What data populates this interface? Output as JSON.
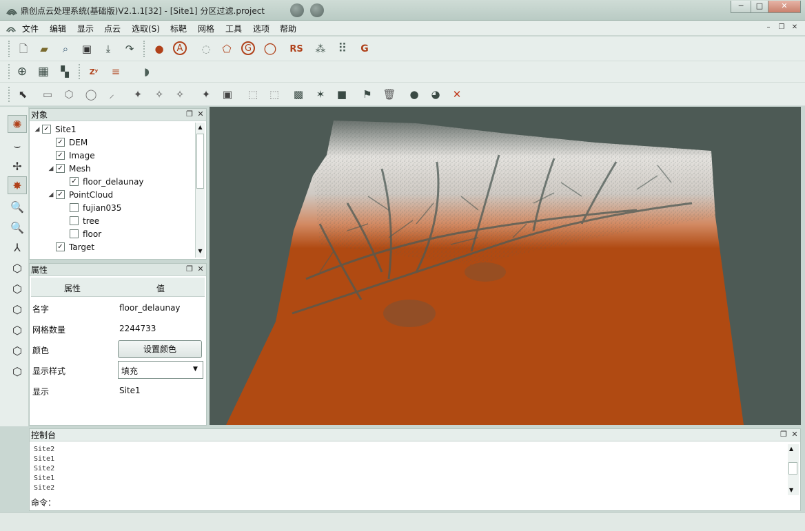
{
  "window": {
    "title": "鼎创点云处理系统(基础版)V2.1.1[32] - [Site1] 分区过滤.project",
    "controls": {
      "minimize": "─",
      "maximize": "□",
      "close": "✕"
    }
  },
  "menubar": {
    "items": [
      "文件",
      "编辑",
      "显示",
      "点云",
      "选取(S)",
      "标靶",
      "网格",
      "工具",
      "选项",
      "帮助"
    ],
    "mdi_controls": {
      "minimize": "–",
      "restore": "❐",
      "close": "✕"
    }
  },
  "objects_panel": {
    "title": "对象",
    "tree": [
      {
        "label": "Site1",
        "checked": true,
        "expander": "◢",
        "indent": 0
      },
      {
        "label": "DEM",
        "checked": true,
        "expander": "",
        "indent": 1
      },
      {
        "label": "Image",
        "checked": true,
        "expander": "",
        "indent": 1
      },
      {
        "label": "Mesh",
        "checked": true,
        "expander": "◢",
        "indent": 1
      },
      {
        "label": "floor_delaunay",
        "checked": true,
        "expander": "",
        "indent": 2
      },
      {
        "label": "PointCloud",
        "checked": true,
        "expander": "◢",
        "indent": 1
      },
      {
        "label": "fujian035",
        "checked": false,
        "expander": "",
        "indent": 2
      },
      {
        "label": "tree",
        "checked": false,
        "expander": "",
        "indent": 2
      },
      {
        "label": "floor",
        "checked": false,
        "expander": "",
        "indent": 2
      },
      {
        "label": "Target",
        "checked": true,
        "expander": "",
        "indent": 1
      }
    ]
  },
  "properties_panel": {
    "title": "属性",
    "header": {
      "property": "属性",
      "value": "值"
    },
    "rows": {
      "name_key": "名字",
      "name_value": "floor_delaunay",
      "mesh_count_key": "网格数量",
      "mesh_count_value": "2244733",
      "color_key": "颜色",
      "color_button": "设置颜色",
      "style_key": "显示样式",
      "style_value": "填充",
      "display_key": "显示",
      "display_value": "Site1"
    }
  },
  "console": {
    "title": "控制台",
    "lines": [
      "Site2",
      "Site1",
      "Site2",
      "Site1",
      "Site2"
    ],
    "command_label": "命令："
  },
  "colors": {
    "mesh_orange": "#b04a12",
    "viewport_background": "#4d5a55",
    "terrain_light": "#e4e2de"
  },
  "toolbar_icons": {
    "row1": [
      "new-file-icon",
      "open-folder-icon",
      "search-file-icon",
      "save-icon",
      "export-icon",
      "import-icon",
      "point-cloud-icon",
      "circle-a-icon",
      "dots-ring-icon",
      "polygon-icon",
      "circle-g-icon",
      "circle-o-icon",
      "rs-icon",
      "scatter-icon",
      "grid-dots-icon",
      "circle-g2-icon"
    ],
    "row2": [
      "sphere-grid-icon",
      "grid-icon",
      "chart-icon",
      "axes-xyz-icon",
      "level-icon",
      "mesh-shape-icon"
    ],
    "row3": [
      "select-pointer-icon",
      "rect-select-icon",
      "poly-select-icon",
      "circle-select-icon",
      "brush-select-icon",
      "star-select-icon",
      "star-add-icon",
      "star-sub-icon",
      "star-fill-icon",
      "box-select-icon",
      "box-icon",
      "box-outline-icon",
      "star-box-icon",
      "pin-star-icon",
      "square-icon",
      "flag-icon",
      "trash-icon",
      "ball-icon",
      "ball-star-icon",
      "delete-x-icon"
    ]
  }
}
